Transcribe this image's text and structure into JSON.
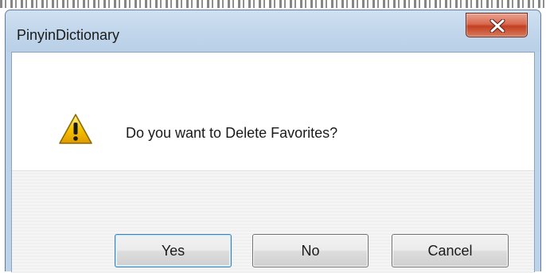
{
  "window": {
    "title": "PinyinDictionary",
    "close_icon": "close-icon"
  },
  "dialog": {
    "icon": "warning-icon",
    "message": "Do you want to Delete Favorites?"
  },
  "buttons": {
    "yes_label": "Yes",
    "no_label": "No",
    "cancel_label": "Cancel"
  },
  "colors": {
    "titlebar": "#c0d5ea",
    "close_button": "#c33f22",
    "warning_fill": "#f5c400",
    "button_area": "#f0f0f0"
  }
}
